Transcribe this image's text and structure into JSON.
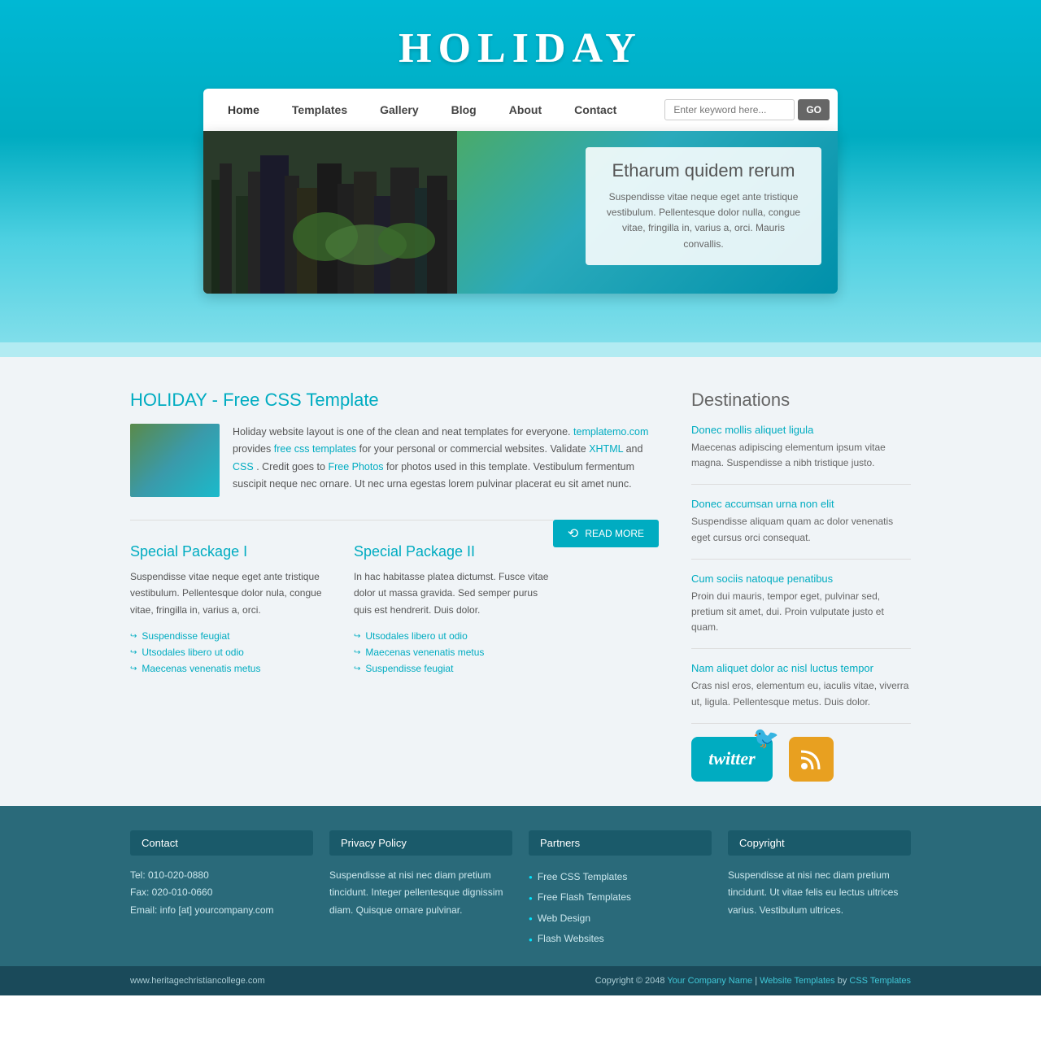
{
  "site": {
    "title": "HOLIDAY",
    "reflection": "HOLIDAY"
  },
  "nav": {
    "links": [
      {
        "label": "Home",
        "active": true
      },
      {
        "label": "Templates",
        "active": false
      },
      {
        "label": "Gallery",
        "active": false
      },
      {
        "label": "Blog",
        "active": false
      },
      {
        "label": "About",
        "active": false
      },
      {
        "label": "Contact",
        "active": false
      }
    ],
    "search_placeholder": "Enter keyword here...",
    "search_button": "GO"
  },
  "hero": {
    "title": "Etharum quidem rerum",
    "body": "Suspendisse vitae neque eget ante tristique vestibulum. Pellentesque dolor nulla, congue vitae, fringilla in, varius a, orci. Mauris convallis."
  },
  "main": {
    "about_title": "HOLIDAY - Free CSS Template",
    "about_text_1": "Holiday website layout is one of the clean and neat templates for everyone.",
    "about_link1": "templatemo.com",
    "about_text_2": "provides",
    "about_link2": "free css templates",
    "about_text_3": "for your personal or commercial websites. Validate",
    "about_link3": "XHTML",
    "about_text_4": "and",
    "about_link4": "CSS",
    "about_text_5": ". Credit goes to",
    "about_link5": "Free Photos",
    "about_text_6": "for photos used in this template. Vestibulum fermentum suscipit neque nec ornare. Ut nec urna egestas lorem pulvinar placerat eu sit amet nunc.",
    "read_more": "READ MORE",
    "package1": {
      "title": "Special Package I",
      "text": "Suspendisse vitae neque eget ante tristique vestibulum. Pellentesque dolor nula, congue vitae, fringilla in, varius a, orci.",
      "items": [
        "Suspendisse feugiat",
        "Utsodales libero ut odio",
        "Maecenas venenatis metus"
      ]
    },
    "package2": {
      "title": "Special Package II",
      "text": "In hac habitasse platea dictumst. Fusce vitae dolor ut massa gravida. Sed semper purus quis est hendrerit. Duis dolor.",
      "items": [
        "Utsodales libero ut odio",
        "Maecenas venenatis metus",
        "Suspendisse feugiat"
      ]
    }
  },
  "destinations": {
    "title": "Destinations",
    "items": [
      {
        "title": "Donec mollis aliquet ligula",
        "text": "Maecenas adipiscing elementum ipsum vitae magna. Suspendisse a nibh tristique justo."
      },
      {
        "title": "Donec accumsan urna non elit",
        "text": "Suspendisse aliquam quam ac dolor venenatis eget cursus orci consequat."
      },
      {
        "title": "Cum sociis natoque penatibus",
        "text": "Proin dui mauris, tempor eget, pulvinar sed, pretium sit amet, dui. Proin vulputate justo et quam."
      },
      {
        "title": "Nam aliquet dolor ac nisl luctus tempor",
        "text": "Cras nisl eros, elementum eu, iaculis vitae, viverra ut, ligula. Pellentesque metus. Duis dolor."
      }
    ]
  },
  "footer": {
    "columns": [
      {
        "title": "Contact",
        "content": "Tel: 010-020-0880\nFax: 020-010-0660\nEmail: info [at] yourcompany.com"
      },
      {
        "title": "Privacy Policy",
        "content": "Suspendisse at nisi nec diam pretium tincidunt. Integer pellentesque dignissim diam. Quisque ornare pulvinar."
      },
      {
        "title": "Partners",
        "links": [
          "Free CSS Templates",
          "Free Flash Templates",
          "Web Design",
          "Flash Websites"
        ]
      },
      {
        "title": "Copyright",
        "content": "Suspendisse at nisi nec diam pretium tincidunt. Ut vitae felis eu lectus ultrices varius. Vestibulum ultrices."
      }
    ],
    "bottom_left": "www.heritagechristiancollege.com",
    "bottom_copy": "Copyright © 2048",
    "bottom_link1": "Your Company Name",
    "bottom_sep1": " | ",
    "bottom_link2": "Website Templates",
    "bottom_text": " by ",
    "bottom_link3": "CSS Templates"
  }
}
